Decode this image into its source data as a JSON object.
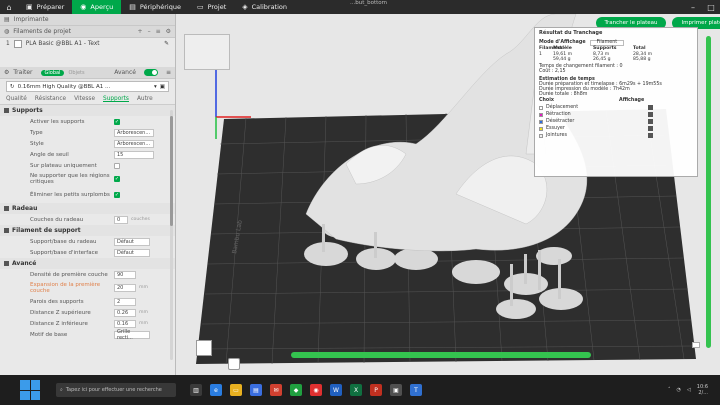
{
  "app": {
    "window_title": "...but_bottom",
    "tabs": [
      {
        "label": "Préparer",
        "icon": "cube-icon"
      },
      {
        "label": "Aperçu",
        "icon": "eye-icon"
      },
      {
        "label": "Périphérique",
        "icon": "printer-icon"
      },
      {
        "label": "Projet",
        "icon": "folder-icon"
      },
      {
        "label": "Calibration",
        "icon": "calibration-icon"
      }
    ]
  },
  "left": {
    "printer_header": "Imprimante",
    "filament_header": "Filaments de projet",
    "filament_item": "PLA Basic @BBL A1 - Text",
    "filament_number": "1",
    "traiter_label": "Traiter",
    "global_pill": "Global",
    "objects_pill": "Objets",
    "advanced_label": "Avancé",
    "preset": "0.16mm High Quality @BBL A1 ...",
    "tabs": [
      "Qualité",
      "Résistance",
      "Vitesse",
      "Supports",
      "Autre"
    ],
    "sections": {
      "supports": "Supports",
      "radeau": "Radeau",
      "filament_support": "Filament de support",
      "avance": "Avancé"
    },
    "opts": {
      "enable": "Activer les supports",
      "type": "Type",
      "type_val": "Arborescen...",
      "style": "Style",
      "style_val": "Arborescen...",
      "threshold": "Angle de seuil",
      "threshold_val": "15",
      "on_plate": "Sur plateau uniquement",
      "critical": "Ne supporter que les régions critiques",
      "remove_small": "Éliminer les petits surplombs",
      "raft_layers": "Couches du radeau",
      "raft_val": "0",
      "raft_unit": "couches",
      "sup_base": "Support/base du radeau",
      "sup_base_val": "Défaut",
      "sup_iface": "Support/base d'interface",
      "sup_iface_val": "Défaut",
      "first_density": "Densité de première couche",
      "first_density_val": "90",
      "first_expansion": "Expansion de la première couche",
      "first_expansion_val": "20",
      "first_expansion_unit": "mm",
      "wall_loops": "Parois des supports",
      "wall_loops_val": "2",
      "top_z": "Distance Z supérieure",
      "top_z_val": "0.26",
      "top_z_unit": "mm",
      "bottom_z": "Distance Z inférieure",
      "bottom_z_val": "0.16",
      "bottom_z_unit": "mm",
      "base_pattern": "Motif de base",
      "base_pattern_val": "Grille recti..."
    }
  },
  "viewport": {
    "slice_button": "Trancher le plateau",
    "print_button": "Imprimer plate",
    "bed_label": "Bambu Lab",
    "result": {
      "title": "Résultat du Tranchage",
      "display_mode_label": "Mode d'Affichage",
      "display_mode_val": "Filament",
      "headers": [
        "Filament",
        "Modèle",
        "Supports",
        "Total"
      ],
      "row": {
        "idx": "1",
        "model": "19,61 m\n59,44 g",
        "supports": "8,73 m\n26,45 g",
        "total": "28,34 m\n85,88 g"
      },
      "change_times": "Temps de changement filament : 0",
      "cost": "Coût : 2,15",
      "time_title": "Estimation de temps",
      "prep_time": "Durée préparation et timelapse : 6m29s + 19m55s",
      "model_time": "Durée impression du modèle : 7h42m",
      "total_time": "Durée totale : 8h8m",
      "legend_header_left": "Choix",
      "legend_header_right": "Affichage",
      "legend": [
        {
          "label": "Déplacement",
          "color": "#ffffff"
        },
        {
          "label": "Rétraction",
          "color": "#e020c0"
        },
        {
          "label": "Désétracter",
          "color": "#2e6ee0"
        },
        {
          "label": "Essuyer",
          "color": "#f0e020"
        },
        {
          "label": "Jointures",
          "color": "#f0f0f0"
        }
      ]
    }
  },
  "taskbar": {
    "search_placeholder": "Tapez ici pour effectuer une recherche",
    "time": "10:6",
    "date": "2/..."
  }
}
